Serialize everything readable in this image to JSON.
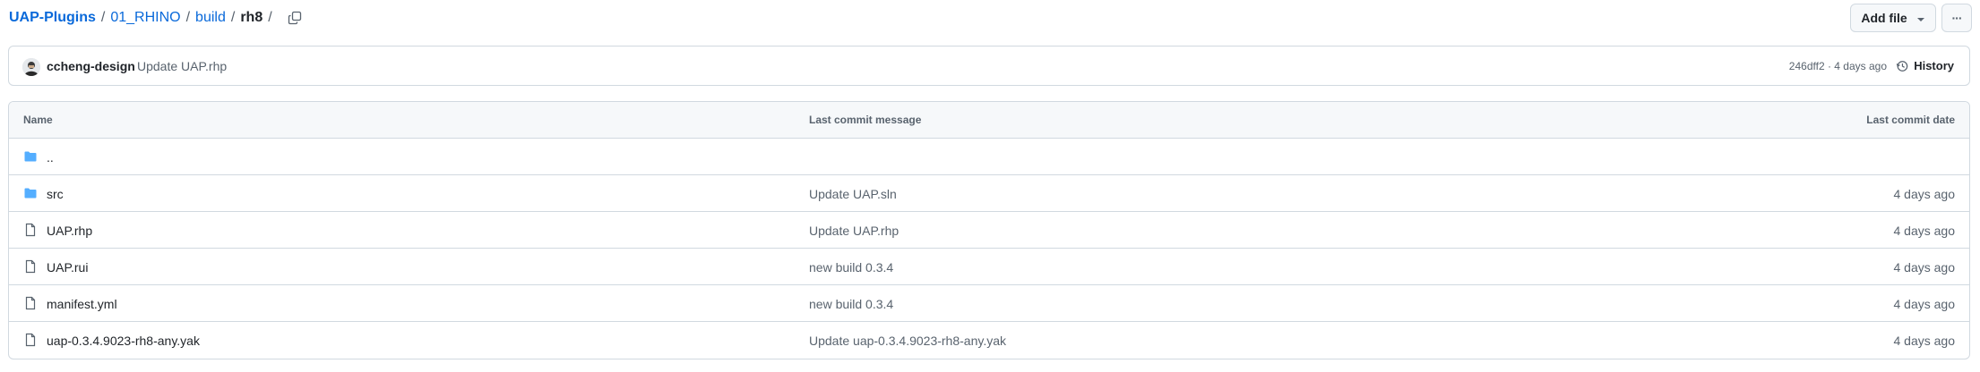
{
  "breadcrumb": {
    "repo": "UAP-Plugins",
    "segments": [
      "01_RHINO",
      "build"
    ],
    "current": "rh8",
    "trailing_separator": "/"
  },
  "toolbar": {
    "add_file_label": "Add file",
    "more_label": "···"
  },
  "commit": {
    "author": "ccheng-design",
    "message": "Update UAP.rhp",
    "meta": "246dff2 · 4 days ago",
    "history_label": "History"
  },
  "table": {
    "headers": {
      "name": "Name",
      "message": "Last commit message",
      "date": "Last commit date"
    },
    "rows": [
      {
        "type": "parent",
        "name": "..",
        "message": "",
        "date": ""
      },
      {
        "type": "folder",
        "name": "src",
        "message": "Update UAP.sln",
        "date": "4 days ago"
      },
      {
        "type": "file",
        "name": "UAP.rhp",
        "message": "Update UAP.rhp",
        "date": "4 days ago"
      },
      {
        "type": "file",
        "name": "UAP.rui",
        "message": "new build 0.3.4",
        "date": "4 days ago"
      },
      {
        "type": "file",
        "name": "manifest.yml",
        "message": "new build 0.3.4",
        "date": "4 days ago"
      },
      {
        "type": "file",
        "name": "uap-0.3.4.9023-rh8-any.yak",
        "message": "Update uap-0.3.4.9023-rh8-any.yak",
        "date": "4 days ago"
      }
    ]
  },
  "icons": {
    "folder": "folder-icon",
    "file": "file-icon",
    "copy": "copy-icon",
    "history": "history-icon",
    "caret": "chevron-down-icon"
  },
  "colors": {
    "link": "#0969da",
    "folder": "#54aeff",
    "border": "#d1d9e0",
    "header_bg": "#f6f8fa",
    "muted_text": "#59636e"
  }
}
